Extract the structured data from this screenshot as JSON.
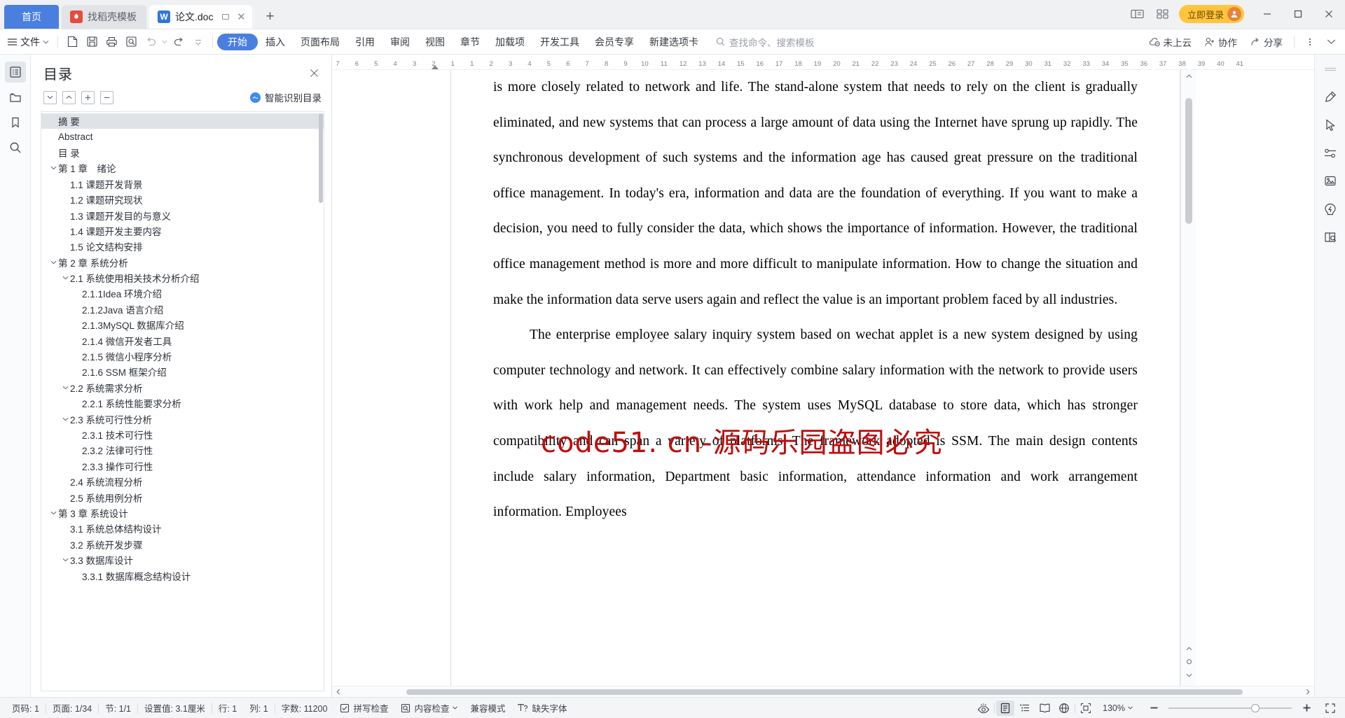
{
  "window": {
    "home_tab": "首页",
    "tabs": [
      {
        "label": "找稻壳模板",
        "icon": "wps-template-icon",
        "active": false
      },
      {
        "label": "论文.doc",
        "icon": "wps-writer-icon",
        "active": true
      }
    ],
    "new_tab": "+",
    "login_label": "立即登录",
    "minimize": "—",
    "maximize": "▢",
    "close": "✕"
  },
  "ribbon": {
    "file_menu": "文件",
    "search_placeholder": "查找命令、搜索模板",
    "tabs": [
      "开始",
      "插入",
      "页面布局",
      "引用",
      "审阅",
      "视图",
      "章节",
      "加载项",
      "开发工具",
      "会员专享",
      "新建选项卡"
    ],
    "selected_tab": "开始",
    "right_items": [
      {
        "label": "未上云",
        "icon": "cloud-off-icon"
      },
      {
        "label": "协作",
        "icon": "collaborate-icon"
      },
      {
        "label": "分享",
        "icon": "share-icon"
      }
    ]
  },
  "left_rail": [
    {
      "name": "outline-icon",
      "active": true
    },
    {
      "name": "folder-icon",
      "active": false
    },
    {
      "name": "bookmark-icon",
      "active": false
    },
    {
      "name": "search-icon",
      "active": false
    }
  ],
  "toc": {
    "title": "目录",
    "smart_label": "智能识别目录",
    "tools": [
      "collapse-down",
      "collapse-up",
      "expand-all",
      "collapse-all"
    ],
    "items": [
      {
        "label": "摘 要",
        "level": 0,
        "caret": "",
        "selected": true
      },
      {
        "label": "Abstract",
        "level": 0,
        "caret": "",
        "selected": false
      },
      {
        "label": "目 录",
        "level": 0,
        "caret": "",
        "selected": false
      },
      {
        "label": "第 1 章　绪论",
        "level": 0,
        "caret": "down",
        "selected": false
      },
      {
        "label": "1.1 课题开发背景",
        "level": 1,
        "caret": "",
        "selected": false
      },
      {
        "label": "1.2 课题研究现状",
        "level": 1,
        "caret": "",
        "selected": false
      },
      {
        "label": "1.3 课题开发目的与意义",
        "level": 1,
        "caret": "",
        "selected": false
      },
      {
        "label": "1.4 课题开发主要内容",
        "level": 1,
        "caret": "",
        "selected": false
      },
      {
        "label": "1.5 论文结构安排",
        "level": 1,
        "caret": "",
        "selected": false
      },
      {
        "label": "第 2 章  系统分析",
        "level": 0,
        "caret": "down",
        "selected": false
      },
      {
        "label": "2.1 系统使用相关技术分析介绍",
        "level": 1,
        "caret": "down",
        "selected": false
      },
      {
        "label": "2.1.1Idea 环境介绍",
        "level": 2,
        "caret": "",
        "selected": false
      },
      {
        "label": "2.1.2Java 语言介绍",
        "level": 2,
        "caret": "",
        "selected": false
      },
      {
        "label": " 2.1.3MySQL 数据库介绍",
        "level": 2,
        "caret": "",
        "selected": false
      },
      {
        "label": "2.1.4 微信开发者工具",
        "level": 2,
        "caret": "",
        "selected": false
      },
      {
        "label": "2.1.5 微信小程序分析",
        "level": 2,
        "caret": "",
        "selected": false
      },
      {
        "label": "2.1.6 SSM 框架介绍",
        "level": 2,
        "caret": "",
        "selected": false
      },
      {
        "label": "2.2 系统需求分析",
        "level": 1,
        "caret": "down",
        "selected": false
      },
      {
        "label": "2.2.1 系统性能要求分析",
        "level": 2,
        "caret": "",
        "selected": false
      },
      {
        "label": "2.3 系统可行性分析",
        "level": 1,
        "caret": "down",
        "selected": false
      },
      {
        "label": "2.3.1 技术可行性",
        "level": 2,
        "caret": "",
        "selected": false
      },
      {
        "label": "2.3.2 法律可行性",
        "level": 2,
        "caret": "",
        "selected": false
      },
      {
        "label": "2.3.3 操作可行性",
        "level": 2,
        "caret": "",
        "selected": false
      },
      {
        "label": "2.4 系统流程分析",
        "level": 1,
        "caret": "",
        "selected": false
      },
      {
        "label": "2.5 系统用例分析",
        "level": 1,
        "caret": "",
        "selected": false
      },
      {
        "label": "第 3 章  系统设计",
        "level": 0,
        "caret": "down",
        "selected": false
      },
      {
        "label": "3.1 系统总体结构设计",
        "level": 1,
        "caret": "",
        "selected": false
      },
      {
        "label": "3.2 系统开发步骤",
        "level": 1,
        "caret": "",
        "selected": false
      },
      {
        "label": "3.3 数据库设计",
        "level": 1,
        "caret": "down",
        "selected": false
      },
      {
        "label": "3.3.1 数据库概念结构设计",
        "level": 2,
        "caret": "",
        "selected": false
      }
    ]
  },
  "ruler": {
    "ticks": [
      "7",
      "6",
      "5",
      "4",
      "3",
      "2",
      "1",
      "1",
      "2",
      "3",
      "4",
      "5",
      "6",
      "7",
      "8",
      "9",
      "10",
      "11",
      "12",
      "13",
      "14",
      "15",
      "16",
      "17",
      "18",
      "19",
      "20",
      "21",
      "22",
      "23",
      "24",
      "25",
      "26",
      "27",
      "28",
      "29",
      "30",
      "31",
      "32",
      "33",
      "34",
      "35",
      "36",
      "37",
      "38",
      "39",
      "40",
      "41"
    ]
  },
  "document": {
    "paragraphs": [
      "is more closely related to network and life. The stand-alone system that needs to rely on the client is gradually eliminated, and new systems that can process a large amount of data using the Internet have sprung up rapidly. The synchronous development of such systems and the information age has caused great pressure on the traditional office management. In today's era, information and data are the foundation of everything. If you want to make a decision, you need to fully consider the data, which shows the importance of information. However, the traditional office management method is more and more difficult to manipulate information. How to change the situation and make the information data serve users again and reflect the value is an important problem faced by all industries.",
      "The enterprise employee salary inquiry system based on wechat applet is a new system designed by using computer technology and network. It can effectively combine salary information with the network to provide users with work help and management needs. The system uses MySQL database to store data, which has stronger compatibility and can span a variety of platforms. The framework adopted is SSM. The main design contents include salary information, Department basic information, attendance information and work arrangement information. Employees"
    ],
    "watermark": "code51. cn-源码乐园盗图必究"
  },
  "right_rail": [
    "divider-icon",
    "pen-icon",
    "cursor-icon",
    "sliders-icon",
    "image-effects-icon",
    "smart-shape-icon",
    "book-search-icon"
  ],
  "status": {
    "page_number": "页码: 1",
    "page_total": "页面: 1/34",
    "section": "节: 1/1",
    "setting_value": "设置值: 3.1厘米",
    "row": "行: 1",
    "column": "列: 1",
    "word_count": "字数: 11200",
    "spell_check": "拼写检查",
    "content_check": "内容检查",
    "compat_mode": "兼容模式",
    "missing_font": "缺失字体",
    "zoom": "130%",
    "view_icons": [
      "eye-icon",
      "page-view-icon",
      "outline-view-icon",
      "read-view-icon",
      "web-view-icon",
      "fit-page-icon"
    ],
    "zoom_out": "−",
    "zoom_in": "+",
    "fullscreen": "fullscreen-icon"
  },
  "colors": {
    "accent": "#4a7fe0",
    "login_yellow": "#ffc53d",
    "watermark_red": "#c00d0d",
    "toc_selected": "#dfe2e6"
  }
}
